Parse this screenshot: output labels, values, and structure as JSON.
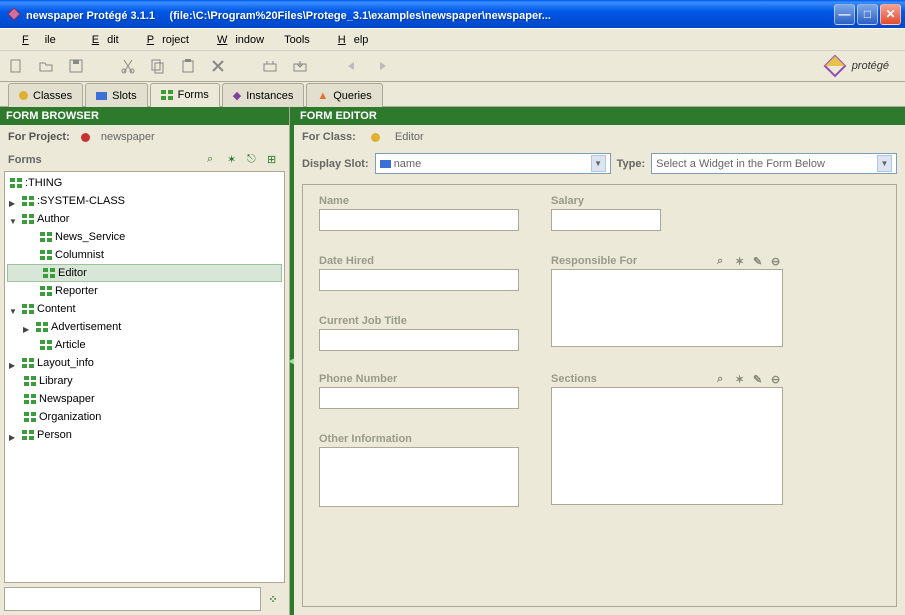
{
  "titlebar": {
    "app": "newspaper  Protégé 3.1.1",
    "path": "(file:\\C:\\Program%20Files\\Protege_3.1\\examples\\newspaper\\newspaper..."
  },
  "menu": {
    "file": "File",
    "edit": "Edit",
    "project": "Project",
    "window": "Window",
    "tools": "Tools",
    "help": "Help"
  },
  "tabs": {
    "classes": "Classes",
    "slots": "Slots",
    "forms": "Forms",
    "instances": "Instances",
    "queries": "Queries"
  },
  "logo": "protégé",
  "browser": {
    "title": "FORM BROWSER",
    "for_project_label": "For Project:",
    "project_name": "newspaper",
    "forms_label": "Forms"
  },
  "tree": {
    "thing": ":THING",
    "system_class": ":SYSTEM-CLASS",
    "author": "Author",
    "news_service": "News_Service",
    "columnist": "Columnist",
    "editor": "Editor",
    "reporter": "Reporter",
    "content": "Content",
    "advertisement": "Advertisement",
    "article": "Article",
    "layout_info": "Layout_info",
    "library": "Library",
    "newspaper": "Newspaper",
    "organization": "Organization",
    "person": "Person"
  },
  "editor": {
    "title": "FORM EDITOR",
    "for_class_label": "For Class:",
    "class_name": "Editor",
    "display_slot_label": "Display Slot:",
    "display_slot_value": "name",
    "type_label": "Type:",
    "type_value": "Select a Widget in the Form Below"
  },
  "form_fields": {
    "name": "Name",
    "salary": "Salary",
    "date_hired": "Date Hired",
    "responsible_for": "Responsible For",
    "current_job_title": "Current Job Title",
    "phone_number": "Phone Number",
    "sections": "Sections",
    "other_information": "Other Information"
  }
}
